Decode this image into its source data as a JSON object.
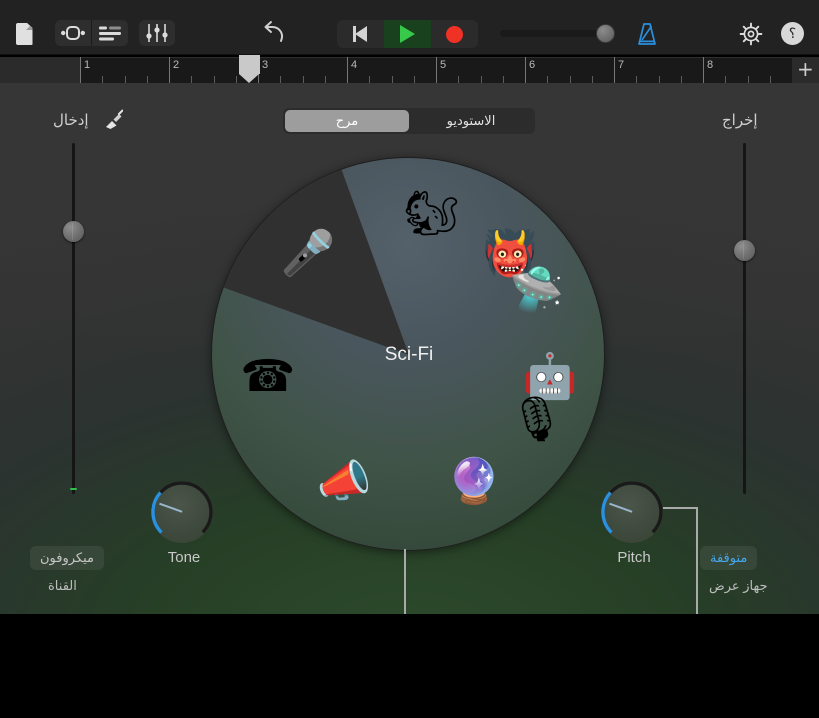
{
  "app": {
    "title": "GarageBand",
    "locale": "ar",
    "accent_blue": "#2a90e0",
    "record_red": "#f03125",
    "play_green": "#36c94a",
    "panel_green": "#2d4a2c"
  },
  "toolbar": {
    "document_icon": "document-icon",
    "loops_icon": "loop-browser-icon",
    "tracks_icon": "track-view-icon",
    "mixer_icon": "mixer-sliders-icon",
    "undo_icon": "undo-arrow-icon",
    "rewind_icon": "rewind-to-start-icon",
    "play_icon": "play-icon",
    "record_icon": "record-icon",
    "metronome_icon": "metronome-icon",
    "settings_icon": "gear-icon",
    "help_icon": "help-icon",
    "help_glyph": "؟",
    "master_volume": 84,
    "metronome_active": true,
    "playing": true
  },
  "ruler": {
    "bars": [
      "1",
      "2",
      "3",
      "4",
      "5",
      "6",
      "7",
      "8"
    ],
    "playhead_bar": "2.9",
    "add_track_label": "+"
  },
  "io": {
    "input_label": "إدخال",
    "output_label": "إخراج",
    "input_icon": "guitar-cable-icon",
    "input_fader_value": 75,
    "output_fader_value": 70
  },
  "segmented": {
    "options": [
      {
        "id": "studio",
        "label": "الاستوديو",
        "selected": false
      },
      {
        "id": "fun",
        "label": "مرح",
        "selected": true
      }
    ]
  },
  "wheel": {
    "selected_name": "Sci-Fi",
    "selected_index": 1,
    "items": [
      {
        "name": "monster",
        "glyph": "👹",
        "angle": 45
      },
      {
        "name": "robot",
        "glyph": "🤖",
        "angle": 99
      },
      {
        "name": "bubbles",
        "glyph": "🔮",
        "angle": 153
      },
      {
        "name": "megaphone",
        "glyph": "📣",
        "angle": 207
      },
      {
        "name": "telephone",
        "glyph": "☎",
        "angle": 261
      },
      {
        "name": "gold-microphone",
        "glyph": "🎤",
        "angle": 315
      },
      {
        "name": "chipmunk",
        "glyph": "🐿",
        "angle": 9
      },
      {
        "name": "ufo-sci-fi",
        "glyph": "🛸",
        "angle": 63
      },
      {
        "name": "studio-microphone",
        "glyph": "🎙",
        "angle": 117
      }
    ]
  },
  "knobs": [
    {
      "id": "tone",
      "label": "Tone",
      "value": 24
    },
    {
      "id": "pitch",
      "label": "Pitch",
      "value": 24
    }
  ],
  "channel": {
    "button_label": "ميكروفون",
    "caption": "القناة"
  },
  "monitor": {
    "button_label": "متوقفة",
    "caption": "جهاز عرض",
    "button_color": "#44a8f0"
  }
}
